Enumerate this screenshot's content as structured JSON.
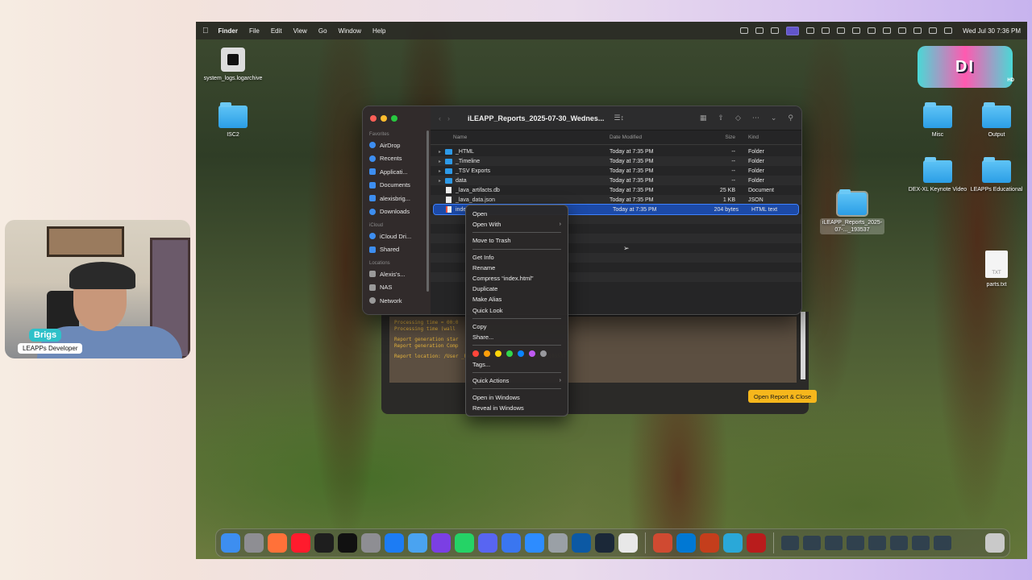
{
  "menubar": {
    "app": "Finder",
    "menus": [
      "File",
      "Edit",
      "View",
      "Go",
      "Window",
      "Help"
    ],
    "clock": "Wed Jul 30  7:36 PM"
  },
  "desktop": {
    "left_icons": [
      {
        "label": "system_logs.logarchive",
        "type": "archive"
      },
      {
        "label": "ISC2",
        "type": "folder"
      }
    ],
    "right_icons": [
      {
        "label": "Misc",
        "type": "folder"
      },
      {
        "label": "Output",
        "type": "folder"
      },
      {
        "label": "DEX-XL Keynote Video",
        "type": "folder"
      },
      {
        "label": "LEAPPs Educational",
        "type": "folder"
      },
      {
        "label": "iLEAPP_Reports_2025-07-..._193537",
        "type": "folder",
        "selected": true
      },
      {
        "label": "parts.txt",
        "type": "file",
        "badge": "TXT"
      }
    ],
    "badge_text": "DI",
    "badge_suffix": "HD"
  },
  "leapp_window": {
    "log_lines": [
      "Processing time = 00:0",
      "Processing time (wall",
      "",
      "Report generation star",
      "Report generation Comp",
      "",
      "Report location: /User                                    _Reports_2025-07-30_Wednesday_193537"
    ],
    "button": "Open Report & Close"
  },
  "finder": {
    "title": "iLEAPP_Reports_2025-07-30_Wednes...",
    "sidebar": [
      {
        "section": "Favorites",
        "items": [
          "AirDrop",
          "Recents",
          "Applicati...",
          "Documents",
          "alexisbrig...",
          "Downloads"
        ]
      },
      {
        "section": "iCloud",
        "items": [
          "iCloud Dri...",
          "Shared"
        ]
      },
      {
        "section": "Locations",
        "items": [
          "Alexis's...",
          "NAS",
          "Network"
        ]
      }
    ],
    "columns": {
      "name": "Name",
      "date": "Date Modified",
      "size": "Size",
      "kind": "Kind"
    },
    "rows": [
      {
        "name": "_HTML",
        "date": "Today at 7:35 PM",
        "size": "--",
        "kind": "Folder",
        "type": "folder"
      },
      {
        "name": "_Timeline",
        "date": "Today at 7:35 PM",
        "size": "--",
        "kind": "Folder",
        "type": "folder"
      },
      {
        "name": "_TSV Exports",
        "date": "Today at 7:35 PM",
        "size": "--",
        "kind": "Folder",
        "type": "folder"
      },
      {
        "name": "data",
        "date": "Today at 7:35 PM",
        "size": "--",
        "kind": "Folder",
        "type": "folder"
      },
      {
        "name": "_lava_artifacts.db",
        "date": "Today at 7:35 PM",
        "size": "25 KB",
        "kind": "Document",
        "type": "doc"
      },
      {
        "name": "_lava_data.json",
        "date": "Today at 7:35 PM",
        "size": "1 KB",
        "kind": "JSON",
        "type": "doc"
      },
      {
        "name": "inde",
        "date": "Today at 7:35 PM",
        "size": "204 bytes",
        "kind": "HTML text",
        "type": "html",
        "selected": true
      }
    ]
  },
  "context_menu": {
    "group1": [
      {
        "label": "Open"
      },
      {
        "label": "Open With",
        "submenu": true
      }
    ],
    "group2": [
      {
        "label": "Move to Trash"
      }
    ],
    "group3": [
      {
        "label": "Get Info"
      },
      {
        "label": "Rename"
      },
      {
        "label": "Compress “index.html”"
      },
      {
        "label": "Duplicate"
      },
      {
        "label": "Make Alias"
      },
      {
        "label": "Quick Look"
      }
    ],
    "group4": [
      {
        "label": "Copy"
      },
      {
        "label": "Share..."
      }
    ],
    "tag_colors": [
      "#ff453a",
      "#ff9f0a",
      "#ffd60a",
      "#32d74b",
      "#0a84ff",
      "#bf5af2",
      "#98989d"
    ],
    "tags_label": "Tags...",
    "group5": [
      {
        "label": "Quick Actions",
        "submenu": true
      }
    ],
    "group6": [
      {
        "label": "Open in Windows"
      },
      {
        "label": "Reveal in Windows"
      }
    ]
  },
  "dock": {
    "apps": [
      {
        "name": "finder",
        "color": "#3d8ef0"
      },
      {
        "name": "launchpad",
        "color": "#8e8e93"
      },
      {
        "name": "firefox",
        "color": "#ff7139"
      },
      {
        "name": "opera",
        "color": "#ff1b2d"
      },
      {
        "name": "terminal",
        "color": "#1e1e1e"
      },
      {
        "name": "apple-tv",
        "color": "#111111"
      },
      {
        "name": "system-settings",
        "color": "#8e8e93"
      },
      {
        "name": "app-store",
        "color": "#1c7cf4"
      },
      {
        "name": "preview",
        "color": "#4aa3f0"
      },
      {
        "name": "github-desktop",
        "color": "#7b3fe4"
      },
      {
        "name": "whatsapp",
        "color": "#25d366"
      },
      {
        "name": "discord",
        "color": "#5865f2"
      },
      {
        "name": "signal",
        "color": "#3a76f0"
      },
      {
        "name": "zoom",
        "color": "#2d8cff"
      },
      {
        "name": "database",
        "color": "#9aa0a6"
      },
      {
        "name": "edge",
        "color": "#0c59a4"
      },
      {
        "name": "steam",
        "color": "#1b2838"
      },
      {
        "name": "textedit",
        "color": "#e8e8e8"
      },
      {
        "name": "remote-desktop",
        "color": "#d04a31"
      },
      {
        "name": "vscode",
        "color": "#0078d4"
      },
      {
        "name": "powerpoint",
        "color": "#c43e1c"
      },
      {
        "name": "globe-app",
        "color": "#2aa8d8"
      },
      {
        "name": "red-app",
        "color": "#b91c1c"
      }
    ]
  },
  "webcam": {
    "name": "Brigs",
    "role": "LEAPPs Developer"
  }
}
